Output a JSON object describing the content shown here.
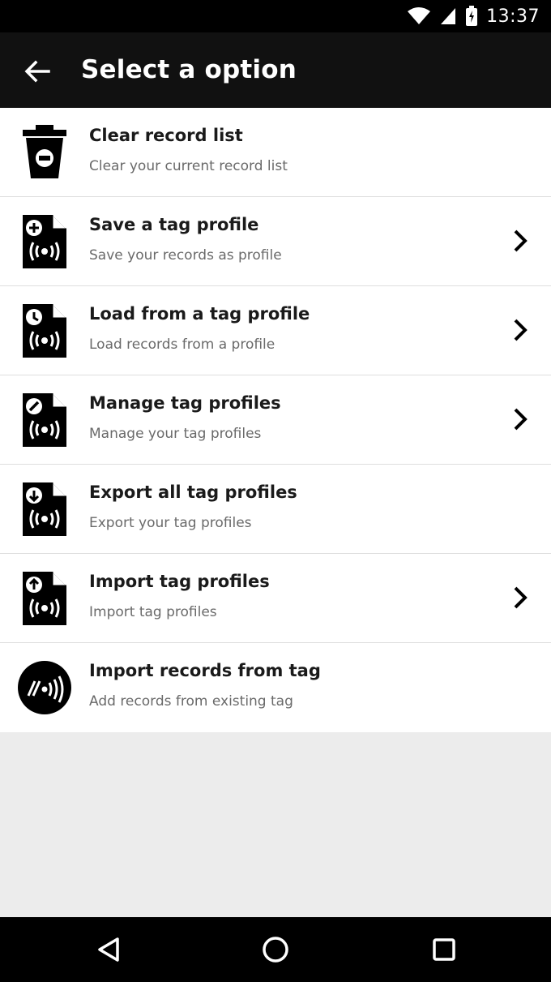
{
  "status_bar": {
    "time": "13:37",
    "icons": [
      "wifi-icon",
      "cell-signal-icon",
      "battery-icon"
    ]
  },
  "toolbar": {
    "title": "Select a option",
    "back_icon": "arrow-left-icon"
  },
  "options": [
    {
      "title": "Clear record list",
      "subtitle": "Clear your current record list",
      "icon": "trash-icon",
      "has_chevron": false
    },
    {
      "title": "Save a tag profile",
      "subtitle": "Save your records as profile",
      "icon": "profile-add-icon",
      "has_chevron": true
    },
    {
      "title": "Load from a tag profile",
      "subtitle": "Load records from a profile",
      "icon": "profile-load-icon",
      "has_chevron": true
    },
    {
      "title": "Manage tag profiles",
      "subtitle": "Manage your tag profiles",
      "icon": "profile-edit-icon",
      "has_chevron": true
    },
    {
      "title": "Export all tag profiles",
      "subtitle": "Export your tag profiles",
      "icon": "profile-export-icon",
      "has_chevron": false
    },
    {
      "title": "Import tag profiles",
      "subtitle": "Import tag profiles",
      "icon": "profile-import-icon",
      "has_chevron": true
    },
    {
      "title": "Import records from tag",
      "subtitle": "Add records from existing tag",
      "icon": "nfc-tag-icon",
      "has_chevron": false
    }
  ],
  "nav_bar": {
    "buttons": [
      "back-triangle-icon",
      "home-circle-icon",
      "recents-square-icon"
    ]
  },
  "colors": {
    "toolbar": "#111111",
    "status_bar": "#000000",
    "list_background": "#ffffff",
    "page_background": "#ececec",
    "subtitle_text": "#6a6a6a"
  }
}
